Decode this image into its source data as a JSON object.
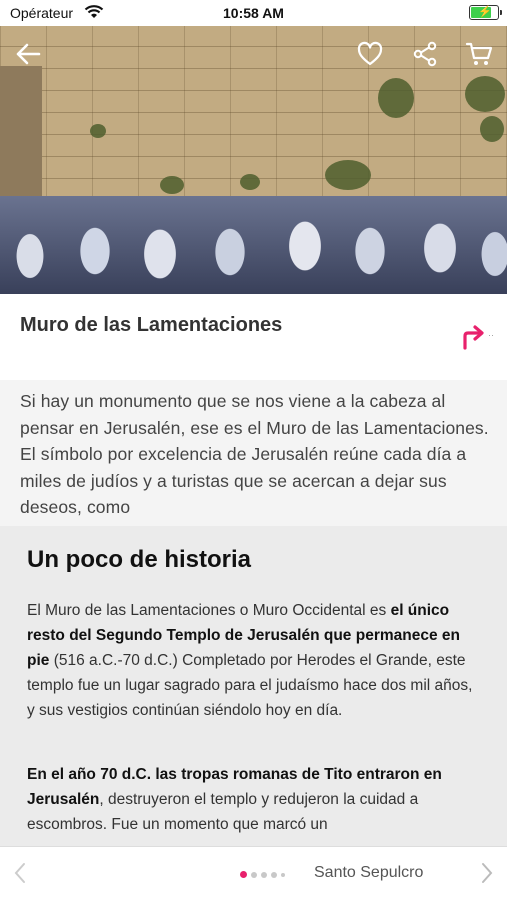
{
  "status_bar": {
    "carrier": "Opérateur",
    "time": "10:58 AM",
    "battery_level": 0.7,
    "wifi_icon": "wifi-icon",
    "battery_icon": "battery-charging-icon"
  },
  "hero": {
    "back_icon": "arrow-left-icon",
    "favorite_icon": "heart-icon",
    "share_icon": "share-icon",
    "cart_icon": "cart-icon"
  },
  "place": {
    "title": "Muro de las Lamentaciones",
    "directions_icon": "directions-turn-icon",
    "accent_color": "#e8216c"
  },
  "intro": {
    "text": "Si hay un monumento que se nos viene a la cabeza al pensar en Jerusalén, ese es el Muro de las Lamentaciones. El símbolo por excelencia de Jerusalén reúne cada día a miles de judíos y a turistas que se acercan a dejar sus deseos, como"
  },
  "history": {
    "heading": "Un poco de historia",
    "p1_a": "El Muro de las Lamentaciones o Muro Occidental es ",
    "p1_b": "el único resto del Segundo Templo de Jerusalén que permanece en pie",
    "p1_c": " (516 a.C.-70 d.C.) Completado por Herodes el Grande, este templo fue un lugar sagrado para el judaísmo hace dos mil años, y sus vestigios continúan siéndolo hoy en día.",
    "p2_a": "En el año 70 d.C. las tropas romanas de Tito entraron en Jerusalén",
    "p2_b": ", destruyeron el templo y redujeron la cuidad a escombros. Fue un momento que marcó un"
  },
  "bottom_nav": {
    "next_label": "Santo Sepulcro",
    "page_count": 5,
    "current_page": 1,
    "prev_icon": "chevron-left-icon",
    "next_icon": "chevron-right-icon"
  }
}
